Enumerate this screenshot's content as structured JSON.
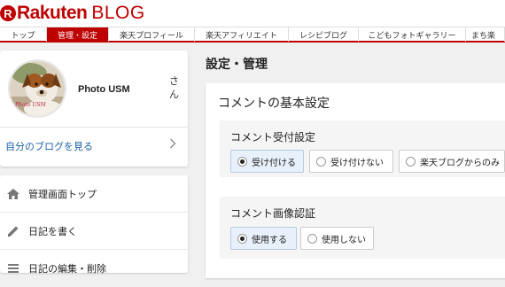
{
  "header": {
    "logo_mark": "R",
    "logo_text": "Rakuten",
    "logo_blog": "BLOG"
  },
  "nav": {
    "items": [
      {
        "label": "トップ",
        "active": false
      },
      {
        "label": "管理・設定",
        "active": true
      },
      {
        "label": "楽天プロフィール",
        "active": false
      },
      {
        "label": "楽天アフィリエイト",
        "active": false
      },
      {
        "label": "レシピブログ",
        "active": false
      },
      {
        "label": "こどもフォトギャラリー",
        "active": false
      },
      {
        "label": "まち楽",
        "active": false
      }
    ]
  },
  "profile": {
    "name": "Photo USM",
    "honorific": "さん",
    "avatar_watermark": "Photo USM",
    "blog_link": "自分のブログを見る"
  },
  "menu": {
    "items": [
      {
        "label": "管理画面トップ",
        "icon": "home-icon"
      },
      {
        "label": "日記を書く",
        "icon": "pencil-icon"
      },
      {
        "label": "日記の編集・削除",
        "icon": "list-icon"
      }
    ]
  },
  "main": {
    "page_title": "設定・管理",
    "section_title": "コメントの基本設定",
    "comment_reception": {
      "title": "コメント受付設定",
      "options": [
        {
          "label": "受け付ける",
          "selected": true
        },
        {
          "label": "受け付けない",
          "selected": false
        },
        {
          "label": "楽天ブログからのみ",
          "selected": false
        }
      ]
    },
    "comment_captcha": {
      "title": "コメント画像認証",
      "options": [
        {
          "label": "使用する",
          "selected": true
        },
        {
          "label": "使用しない",
          "selected": false
        }
      ]
    }
  },
  "colors": {
    "brand": "#bf0000",
    "link": "#1a61a8"
  }
}
